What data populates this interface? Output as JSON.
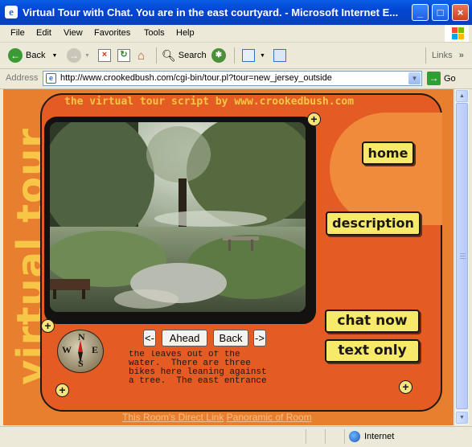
{
  "window": {
    "title": "Virtual Tour with Chat. You are in the east courtyard. - Microsoft Internet E...",
    "app_icon": "e",
    "buttons": [
      "minimize",
      "maximize",
      "close"
    ]
  },
  "menu": {
    "items": [
      "File",
      "Edit",
      "View",
      "Favorites",
      "Tools",
      "Help"
    ]
  },
  "toolbar": {
    "back_label": "Back",
    "search_label": "Search",
    "links_label": "Links"
  },
  "address": {
    "label": "Address",
    "url": "http://www.crookedbush.com/cgi-bin/tour.pl?tour=new_jersey_outside",
    "go_label": "Go"
  },
  "page": {
    "side_title": "virtual tour",
    "headline": "the virtual tour script by www.crookedbush.com",
    "nav": {
      "home": "home",
      "description": "description",
      "chat_now": "chat now",
      "text_only": "text only"
    },
    "controls": {
      "left": "<-",
      "ahead": "Ahead",
      "back": "Back",
      "right": "->"
    },
    "compass": {
      "n": "N",
      "e": "E",
      "s": "S",
      "w": "W"
    },
    "description_text": "the leaves out of the\nwater.  There are three\nbikes here leaning against\na tree.  The east entrance",
    "links": {
      "direct_link": "This Room's Direct Link",
      "panoramic": "Panoramic of Room"
    }
  },
  "status": {
    "zone": "Internet"
  },
  "colors": {
    "page_bg": "#e87f2e",
    "frame": "#e45b23",
    "accent_yellow": "#f7c646",
    "button_yellow": "#f7e96a",
    "title_blue": "#0246d2"
  }
}
